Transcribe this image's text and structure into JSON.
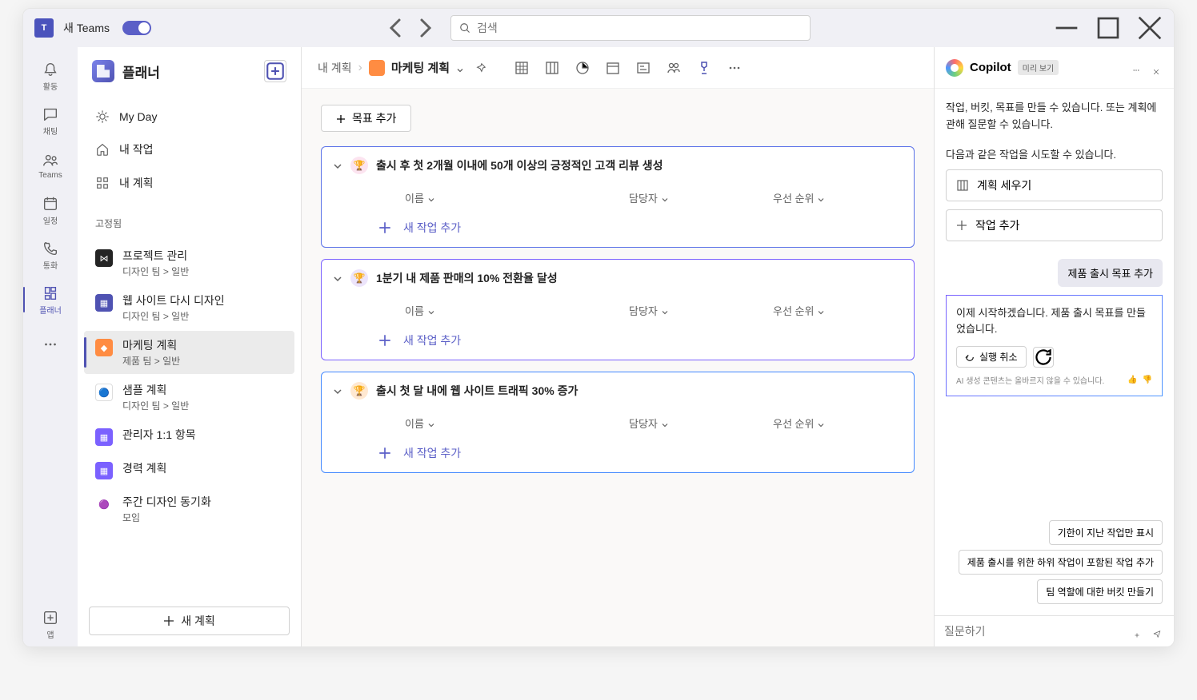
{
  "titlebar": {
    "app_name": "새 Teams",
    "search_placeholder": "검색"
  },
  "apprail": {
    "items": [
      {
        "label": "활동",
        "icon": "bell"
      },
      {
        "label": "채팅",
        "icon": "chat"
      },
      {
        "label": "Teams",
        "icon": "people"
      },
      {
        "label": "일정",
        "icon": "calendar"
      },
      {
        "label": "통화",
        "icon": "phone"
      },
      {
        "label": "플래너",
        "icon": "planner"
      }
    ],
    "more_label": "",
    "apps_label": "앱"
  },
  "sidebar": {
    "title": "플래너",
    "nav": [
      {
        "label": "My Day",
        "icon": "sun"
      },
      {
        "label": "내 작업",
        "icon": "home"
      },
      {
        "label": "내 계획",
        "icon": "grid"
      }
    ],
    "pinned_label": "고정됨",
    "plans": [
      {
        "name": "프로젝트 관리",
        "sub": "디자인 팀 > 일반",
        "color": "#242424"
      },
      {
        "name": "웹 사이트 다시 디자인",
        "sub": "디자인 팀 > 일반",
        "color": "#4f52b2"
      },
      {
        "name": "마케팅 계획",
        "sub": "제품 팀 > 일반",
        "color": "#ff8c42"
      },
      {
        "name": "샘플 계획",
        "sub": "디자인 팀 > 일반",
        "color": "#fff"
      },
      {
        "name": "관리자 1:1 항목",
        "sub": "",
        "color": "#7b61ff"
      },
      {
        "name": "경력 계획",
        "sub": "",
        "color": "#7b61ff"
      },
      {
        "name": "주간 디자인 동기화",
        "sub": "모임",
        "color": "#c239b3"
      }
    ],
    "new_plan": "새 계획"
  },
  "main": {
    "breadcrumb_root": "내 계획",
    "plan_title": "마케팅 계획",
    "add_goal": "목표 추가",
    "columns": {
      "name": "이름",
      "assignee": "담당자",
      "priority": "우선 순위"
    },
    "add_task": "새 작업 추가",
    "goals": [
      {
        "title": "출시 후 첫 2개월 이내에 50개 이상의 긍정적인 고객 리뷰 생성",
        "badge": "pink"
      },
      {
        "title": "1분기 내 제품 판매의 10% 전환율 달성",
        "badge": "purple"
      },
      {
        "title": "출시 첫 달 내에 웹 사이트 트래픽 30% 증가",
        "badge": "orange"
      }
    ]
  },
  "copilot": {
    "title": "Copilot",
    "preview_badge": "미리 보기",
    "intro1": "작업, 버킷, 목표를 만들 수 있습니다. 또는 계획에 관해 질문할 수 있습니다.",
    "intro2": "다음과 같은 작업을 시도할 수 있습니다.",
    "action_plan": "계획 세우기",
    "action_add_task": "작업 추가",
    "user_msg": "제품 출시 목표 추가",
    "ai_msg": "이제 시작하겠습니다. 제품 출시 목표를 만들었습니다.",
    "undo": "실행 취소",
    "disclaimer": "AI 생성 콘텐츠는 올바르지 않을 수 있습니다.",
    "suggestions": [
      "기한이 지난 작업만 표시",
      "제품 출시를 위한 하위 작업이 포함된 작업 추가",
      "팀 역할에 대한 버킷 만들기"
    ],
    "input_placeholder": "질문하기"
  }
}
